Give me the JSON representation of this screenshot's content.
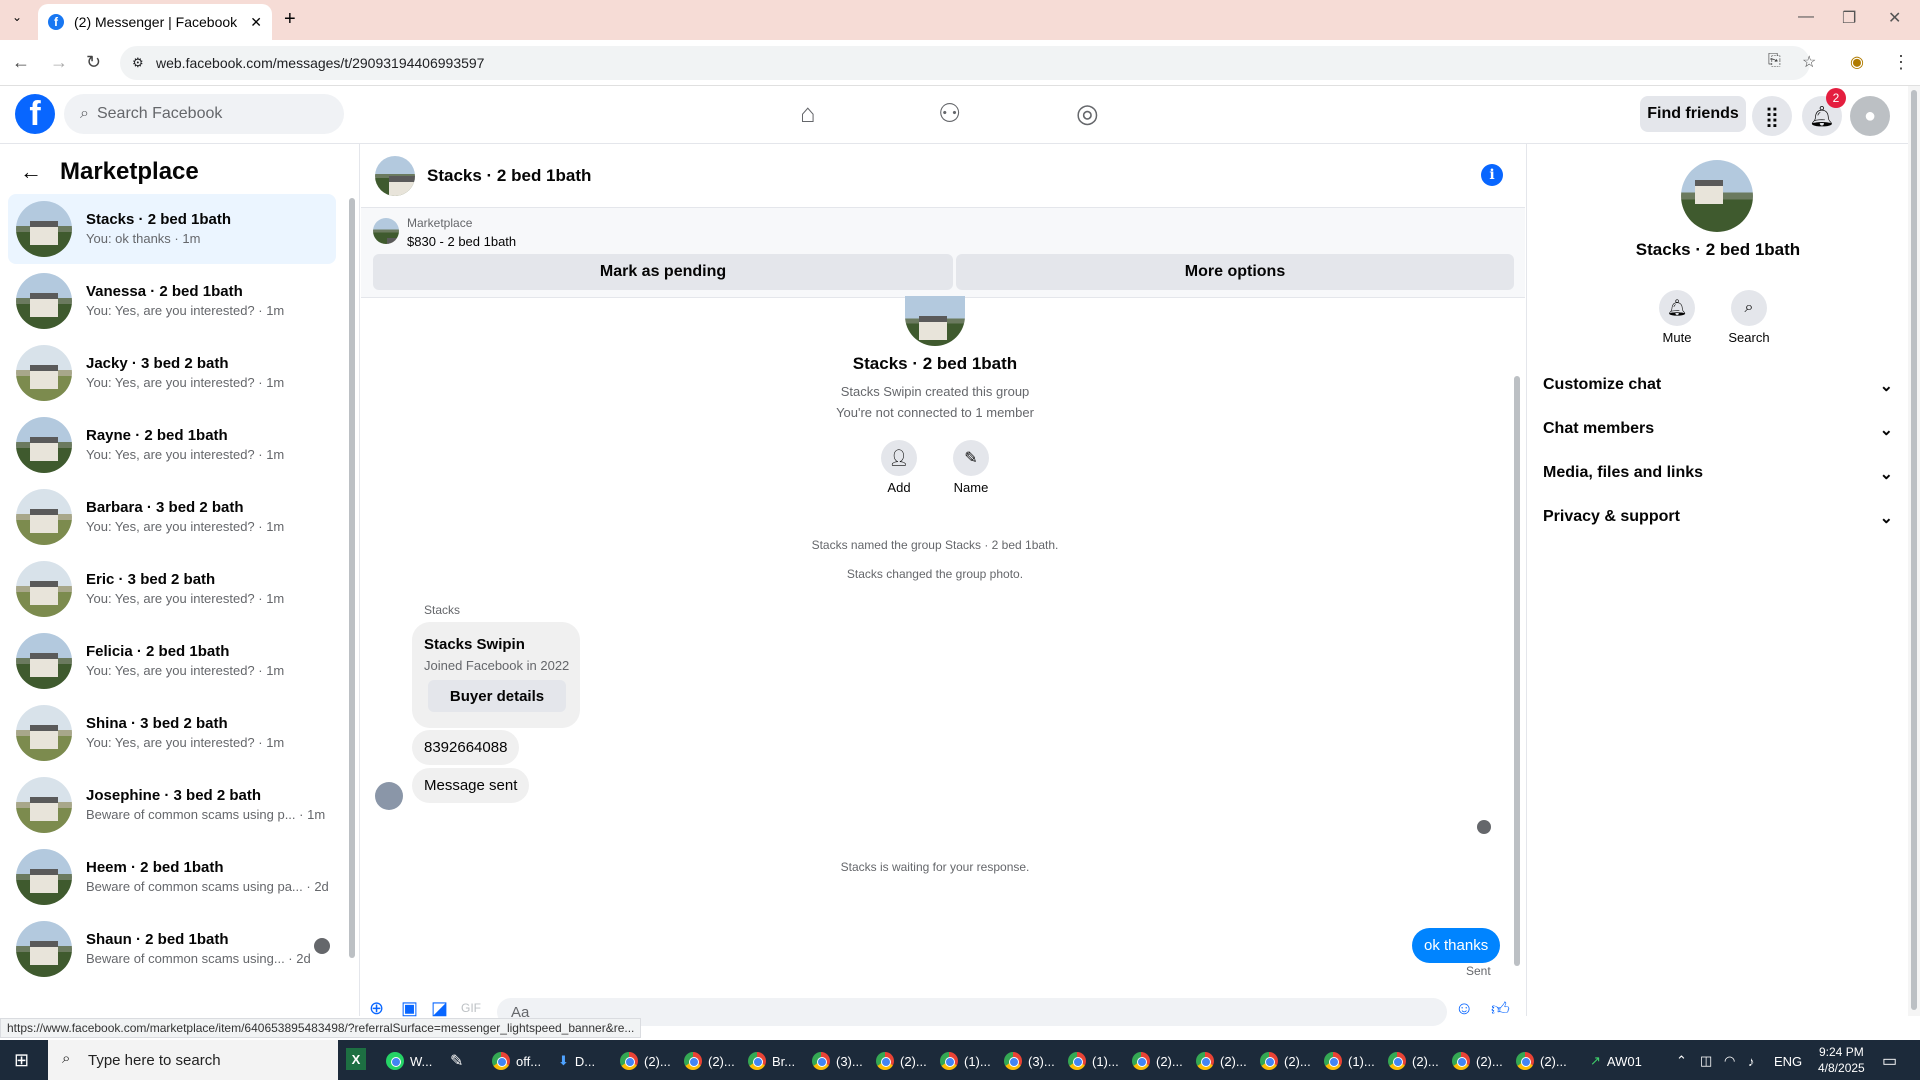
{
  "browser": {
    "tab_title": "(2) Messenger | Facebook",
    "url": "web.facebook.com/messages/t/29093194406993597",
    "status_url": "https://www.facebook.com/marketplace/item/640653895483498/?referralSurface=messenger_lightspeed_banner&re..."
  },
  "header": {
    "search_placeholder": "Search Facebook",
    "find_friends": "Find friends",
    "notif_count": "2"
  },
  "sidebar": {
    "title": "Marketplace",
    "items": [
      {
        "name": "Stacks · 2 bed 1bath",
        "msg": "You: ok thanks · 1m"
      },
      {
        "name": "Vanessa · 2 bed 1bath",
        "msg": "You: Yes, are you interested? · 1m"
      },
      {
        "name": "Jacky · 3 bed 2 bath",
        "msg": "You: Yes, are you interested? · 1m"
      },
      {
        "name": "Rayne · 2 bed 1bath",
        "msg": "You: Yes, are you interested? · 1m"
      },
      {
        "name": "Barbara · 3 bed 2 bath",
        "msg": "You: Yes, are you interested? · 1m"
      },
      {
        "name": "Eric · 3 bed 2 bath",
        "msg": "You: Yes, are you interested? · 1m"
      },
      {
        "name": "Felicia · 2 bed 1bath",
        "msg": "You: Yes, are you interested? · 1m"
      },
      {
        "name": "Shina · 3 bed 2 bath",
        "msg": "You: Yes, are you interested? · 1m"
      },
      {
        "name": "Josephine · 3 bed 2 bath",
        "msg": "Beware of common scams using p... · 1m"
      },
      {
        "name": "Heem · 2 bed 1bath",
        "msg": "Beware of common scams using pa... · 2d"
      },
      {
        "name": "Shaun · 2 bed 1bath",
        "msg": "Beware of common scams using... · 2d"
      }
    ]
  },
  "chat": {
    "title": "Stacks · 2 bed 1bath",
    "marketplace_label": "Marketplace",
    "listing": "$830 - 2 bed 1bath",
    "mark_pending": "Mark as pending",
    "more_options": "More options",
    "group_name": "Stacks · 2 bed 1bath",
    "created_by": "Stacks Swipin created this group",
    "not_connected": "You're not connected to 1 member",
    "add_label": "Add",
    "name_label": "Name",
    "event1": "Stacks named the group Stacks · 2 bed 1bath.",
    "event2": "Stacks changed the group photo.",
    "sender": "Stacks",
    "card_name": "Stacks Swipin",
    "card_joined": "Joined Facebook in 2022",
    "buyer_details": "Buyer details",
    "msg_phone": "8392664088",
    "msg_sent": "Message sent",
    "waiting": "Stacks is waiting for your response.",
    "my_msg": "ok thanks",
    "sent_status": "Sent",
    "composer_placeholder": "Aa"
  },
  "right_panel": {
    "name": "Stacks · 2 bed 1bath",
    "mute": "Mute",
    "search": "Search",
    "sections": [
      "Customize chat",
      "Chat members",
      "Media, files and links",
      "Privacy & support"
    ]
  },
  "taskbar": {
    "search_placeholder": "Type here to search",
    "apps": [
      "W...",
      "off...",
      "D...",
      "(2)...",
      "(2)...",
      "Br...",
      "(3)...",
      "(2)...",
      "(1)...",
      "(3)...",
      "(1)...",
      "(2)...",
      "(2)...",
      "(2)...",
      "(1)...",
      "(2)...",
      "(2)...",
      "(2)..."
    ],
    "tray_label": "AW01",
    "lang": "ENG",
    "time": "9:24 PM",
    "date": "4/8/2025"
  }
}
